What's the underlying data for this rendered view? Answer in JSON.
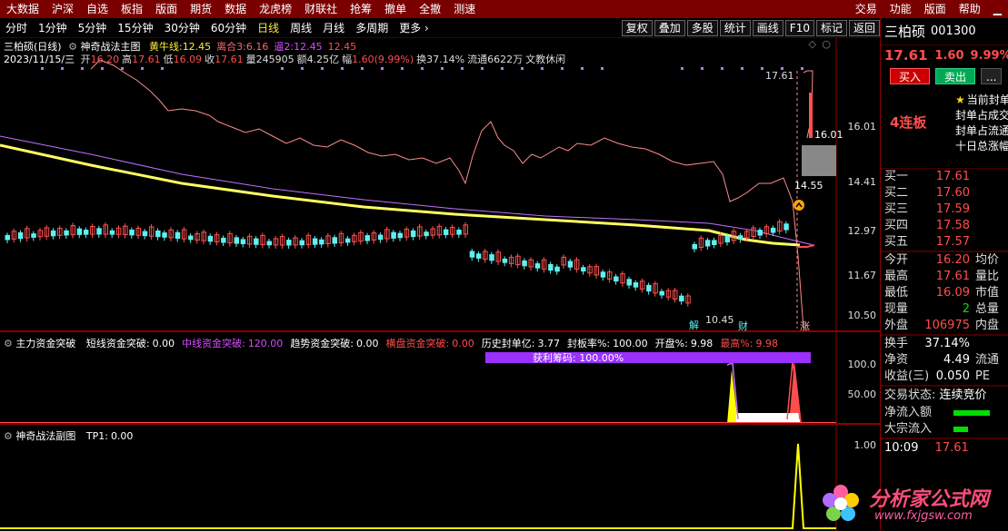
{
  "menubar": {
    "items": [
      "大数据",
      "沪深",
      "自选",
      "板指",
      "版面",
      "期货",
      "数据",
      "龙虎榜",
      "财联社",
      "抢筹",
      "撤单",
      "全撤",
      "测速"
    ],
    "right_items": [
      "交易",
      "功能",
      "版面",
      "帮助"
    ]
  },
  "toolbar": {
    "timeframes": [
      "分时",
      "1分钟",
      "5分钟",
      "15分钟",
      "30分钟",
      "60分钟",
      "日线",
      "周线",
      "月线",
      "多周期",
      "更多 ›"
    ],
    "active_timeframe": "日线",
    "buttons": [
      "复权",
      "叠加",
      "多股",
      "统计",
      "画线",
      "F10",
      "标记",
      "返回"
    ]
  },
  "main_chart": {
    "title": "三柏硕(日线)",
    "indicator_name": "神奇战法主图",
    "indicator_values": [
      {
        "label": "黄牛线:",
        "value": "12.45",
        "color": "#ffeb3b"
      },
      {
        "label": "离合3:",
        "value": "6.16",
        "color": "#ff6666"
      },
      {
        "label": "逼2:",
        "value": "12.45",
        "color": "#d84bff"
      },
      {
        "label": "",
        "value": "12.45",
        "color": "#ff4d4d"
      }
    ],
    "bar_date": "2023/11/15/三",
    "bar_fields": [
      {
        "label": "开",
        "value": "16.20",
        "color": "#ff4d4d"
      },
      {
        "label": "高",
        "value": "17.61",
        "color": "#ff4d4d"
      },
      {
        "label": "低",
        "value": "16.09",
        "color": "#ff4d4d"
      },
      {
        "label": "收",
        "value": "17.61",
        "color": "#ff4d4d"
      },
      {
        "label": "量",
        "value": "245905",
        "color": "#ddd"
      },
      {
        "label": "额",
        "value": "4.25亿",
        "color": "#ddd"
      },
      {
        "label": "幅",
        "value": "1.60(9.99%)",
        "color": "#ff4d4d"
      },
      {
        "label": "换",
        "value": "37.14%",
        "color": "#ddd"
      },
      {
        "label": "流通",
        "value": "6622万",
        "color": "#ddd"
      },
      {
        "label": "",
        "value": "文教休闲",
        "color": "#ddd"
      }
    ],
    "y_ticks": [
      "16.01",
      "14.41",
      "12.97",
      "11.67",
      "10.50"
    ],
    "annotations": {
      "high_label": "17.61",
      "box_top": "16.01",
      "box_bottom": "14.55",
      "low_label": "10.45",
      "marker_jie": "解",
      "marker_cai": "财",
      "marker_zhang": "涨"
    }
  },
  "sub1": {
    "name": "主力资金突破",
    "items": [
      {
        "label": "短线资金突破:",
        "value": "0.00",
        "color": "#ffffff"
      },
      {
        "label": "中线资金突破:",
        "value": "120.00",
        "color": "#d84bff"
      },
      {
        "label": "趋势资金突破:",
        "value": "0.00",
        "color": "#ffffff"
      },
      {
        "label": "横盘资金突破:",
        "value": "0.00",
        "color": "#ff4d4d"
      },
      {
        "label": "历史封单亿:",
        "value": "3.77",
        "color": "#ffffff"
      },
      {
        "label": "封板率%:",
        "value": "100.00",
        "color": "#ffffff"
      },
      {
        "label": "开盘%:",
        "value": "9.98",
        "color": "#ffffff"
      },
      {
        "label": "最高%:",
        "value": "9.98",
        "color": "#ff4d4d"
      }
    ],
    "profit_label": "获利筹码: 100.00%",
    "y_ticks": [
      "100.0",
      "50.00"
    ]
  },
  "sub2": {
    "name": "神奇战法副图",
    "items": [
      {
        "label": "TP1:",
        "value": "0.00",
        "color": "#ffffff"
      }
    ],
    "y_ticks": [
      "1.00"
    ]
  },
  "side": {
    "name": "三柏硕",
    "code": "001300",
    "price": "17.61",
    "change": "1.60",
    "pct": "9.99%",
    "buy_btn": "买入",
    "sell_btn": "卖出",
    "more_btn": "...",
    "lianban": "4连板",
    "notes": [
      "当前封单额",
      "封单占成交",
      "封单占流通",
      "十日总涨幅"
    ],
    "orderbook": [
      {
        "label": "买一",
        "price": "17.61"
      },
      {
        "label": "买二",
        "price": "17.60"
      },
      {
        "label": "买三",
        "price": "17.59"
      },
      {
        "label": "买四",
        "price": "17.58"
      },
      {
        "label": "买五",
        "price": "17.57"
      }
    ],
    "stats": [
      {
        "label": "今开",
        "value": "16.20",
        "ext": "均价",
        "color": "#ff4d4d"
      },
      {
        "label": "最高",
        "value": "17.61",
        "ext": "量比",
        "color": "#ff4d4d"
      },
      {
        "label": "最低",
        "value": "16.09",
        "ext": "市值",
        "color": "#ff4d4d"
      },
      {
        "label": "现量",
        "value": "2",
        "ext": "总量",
        "color": "#00e000"
      },
      {
        "label": "外盘",
        "value": "106975",
        "ext": "内盘",
        "color": "#ff4d4d"
      }
    ],
    "stats2": [
      {
        "label": "换手",
        "value": "37.14%",
        "ext": "",
        "color": "#ffffff"
      },
      {
        "label": "净资",
        "value": "4.49",
        "ext": "流通",
        "color": "#ffffff"
      },
      {
        "label": "收益(三)",
        "value": "0.050",
        "ext": "PE",
        "color": "#ffffff"
      }
    ],
    "trade_status_label": "交易状态:",
    "trade_status": "连续竞价",
    "flow": [
      {
        "label": "净流入额",
        "color": "#00e000"
      },
      {
        "label": "大宗流入",
        "color": "#00e000"
      }
    ],
    "time": "10:09",
    "time_price": "17.61"
  },
  "watermark": {
    "brand": "分析家公式网",
    "url": "www.fxjgsw.com"
  }
}
